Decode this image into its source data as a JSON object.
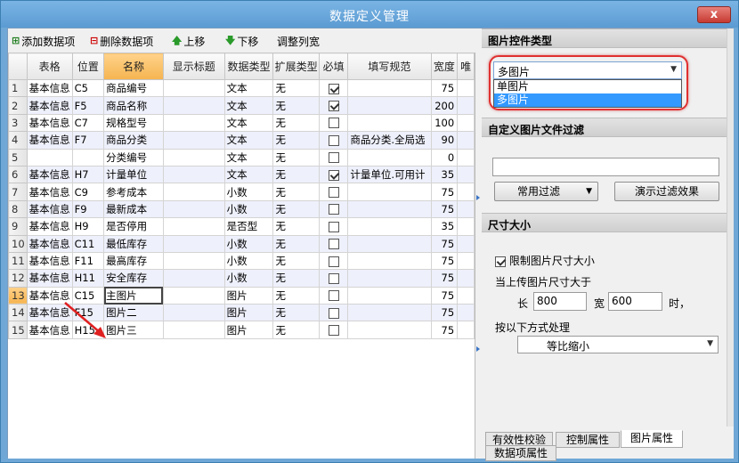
{
  "window": {
    "title": "数据定义管理",
    "close": "x"
  },
  "toolbar": {
    "add": "添加数据项",
    "delete": "删除数据项",
    "up": "上移",
    "down": "下移",
    "adjust_cols": "调整列宽"
  },
  "grid": {
    "columns": [
      "",
      "表格",
      "位置",
      "名称",
      "显示标题",
      "数据类型",
      "扩展类型",
      "必填",
      "填写规范",
      "宽度",
      "唯"
    ],
    "rows": [
      {
        "n": "1",
        "table": "基本信息",
        "pos": "C5",
        "name": "商品编号",
        "title": "",
        "dtype": "文本",
        "ext": "无",
        "req": true,
        "rule": "",
        "width": "75"
      },
      {
        "n": "2",
        "table": "基本信息",
        "pos": "F5",
        "name": "商品名称",
        "title": "",
        "dtype": "文本",
        "ext": "无",
        "req": true,
        "rule": "",
        "width": "200"
      },
      {
        "n": "3",
        "table": "基本信息",
        "pos": "C7",
        "name": "规格型号",
        "title": "",
        "dtype": "文本",
        "ext": "无",
        "req": false,
        "rule": "",
        "width": "100"
      },
      {
        "n": "4",
        "table": "基本信息",
        "pos": "F7",
        "name": "商品分类",
        "title": "",
        "dtype": "文本",
        "ext": "无",
        "req": false,
        "rule": "商品分类.全局选",
        "width": "90"
      },
      {
        "n": "5",
        "table": "",
        "pos": "",
        "name": "分类编号",
        "title": "",
        "dtype": "文本",
        "ext": "无",
        "req": false,
        "rule": "",
        "width": "0"
      },
      {
        "n": "6",
        "table": "基本信息",
        "pos": "H7",
        "name": "计量单位",
        "title": "",
        "dtype": "文本",
        "ext": "无",
        "req": true,
        "rule": "计量单位.可用计",
        "width": "35"
      },
      {
        "n": "7",
        "table": "基本信息",
        "pos": "C9",
        "name": "参考成本",
        "title": "",
        "dtype": "小数",
        "ext": "无",
        "req": false,
        "rule": "",
        "width": "75"
      },
      {
        "n": "8",
        "table": "基本信息",
        "pos": "F9",
        "name": "最新成本",
        "title": "",
        "dtype": "小数",
        "ext": "无",
        "req": false,
        "rule": "",
        "width": "75"
      },
      {
        "n": "9",
        "table": "基本信息",
        "pos": "H9",
        "name": "是否停用",
        "title": "",
        "dtype": "是否型",
        "ext": "无",
        "req": false,
        "rule": "",
        "width": "35"
      },
      {
        "n": "10",
        "table": "基本信息",
        "pos": "C11",
        "name": "最低库存",
        "title": "",
        "dtype": "小数",
        "ext": "无",
        "req": false,
        "rule": "",
        "width": "75"
      },
      {
        "n": "11",
        "table": "基本信息",
        "pos": "F11",
        "name": "最高库存",
        "title": "",
        "dtype": "小数",
        "ext": "无",
        "req": false,
        "rule": "",
        "width": "75"
      },
      {
        "n": "12",
        "table": "基本信息",
        "pos": "H11",
        "name": "安全库存",
        "title": "",
        "dtype": "小数",
        "ext": "无",
        "req": false,
        "rule": "",
        "width": "75"
      },
      {
        "n": "13",
        "table": "基本信息",
        "pos": "C15",
        "name": "主图片",
        "title": "",
        "dtype": "图片",
        "ext": "无",
        "req": false,
        "rule": "",
        "width": "75"
      },
      {
        "n": "14",
        "table": "基本信息",
        "pos": "F15",
        "name": "图片二",
        "title": "",
        "dtype": "图片",
        "ext": "无",
        "req": false,
        "rule": "",
        "width": "75"
      },
      {
        "n": "15",
        "table": "基本信息",
        "pos": "H15",
        "name": "图片三",
        "title": "",
        "dtype": "图片",
        "ext": "无",
        "req": false,
        "rule": "",
        "width": "75"
      }
    ]
  },
  "panel": {
    "section_control_type": "图片控件类型",
    "control_type_value": "多图片",
    "control_type_options": [
      "单图片",
      "多图片"
    ],
    "section_filter": "自定义图片文件过滤",
    "filter_value": "",
    "common_filter": "常用过滤",
    "demo_filter": "演示过滤效果",
    "section_size": "尺寸大小",
    "limit_size_label": "限制图片尺寸大小",
    "limit_size_checked": true,
    "upload_size_label": "当上传图片尺寸大于",
    "length_label": "长",
    "length_value": "800",
    "width_label": "宽",
    "width_value": "600",
    "time_suffix": "时，",
    "process_label": "按以下方式处理",
    "process_value": "等比缩小"
  },
  "tabs": [
    "有效性校验",
    "控制属性",
    "图片属性",
    "数据项属性"
  ],
  "active_tab": "图片属性"
}
